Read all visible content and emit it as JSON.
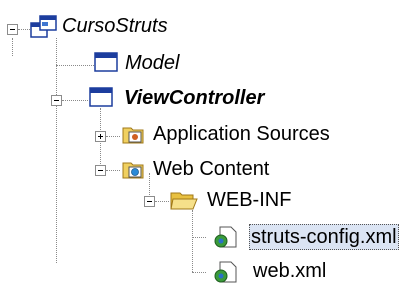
{
  "tree": {
    "items": [
      {
        "label": "CursoStruts",
        "icon": "workspace-project-icon",
        "expanded": true
      },
      {
        "label": "Model",
        "icon": "project-window-icon"
      },
      {
        "label": "ViewController",
        "icon": "project-window-icon",
        "expanded": true
      },
      {
        "label": "Application Sources",
        "icon": "source-folder-icon",
        "expanded": false
      },
      {
        "label": "Web Content",
        "icon": "web-folder-icon",
        "expanded": true
      },
      {
        "label": "WEB-INF",
        "icon": "open-folder-icon",
        "expanded": true
      },
      {
        "label": "struts-config.xml",
        "icon": "xml-file-icon",
        "selected": true
      },
      {
        "label": "web.xml",
        "icon": "xml-file-icon"
      }
    ]
  },
  "colors": {
    "selection_background": "#dbe4f3",
    "window_title_bar": "#1c3d9e",
    "folder_yellow": "#f0d060",
    "tree_lines": "#8a8a8a"
  }
}
